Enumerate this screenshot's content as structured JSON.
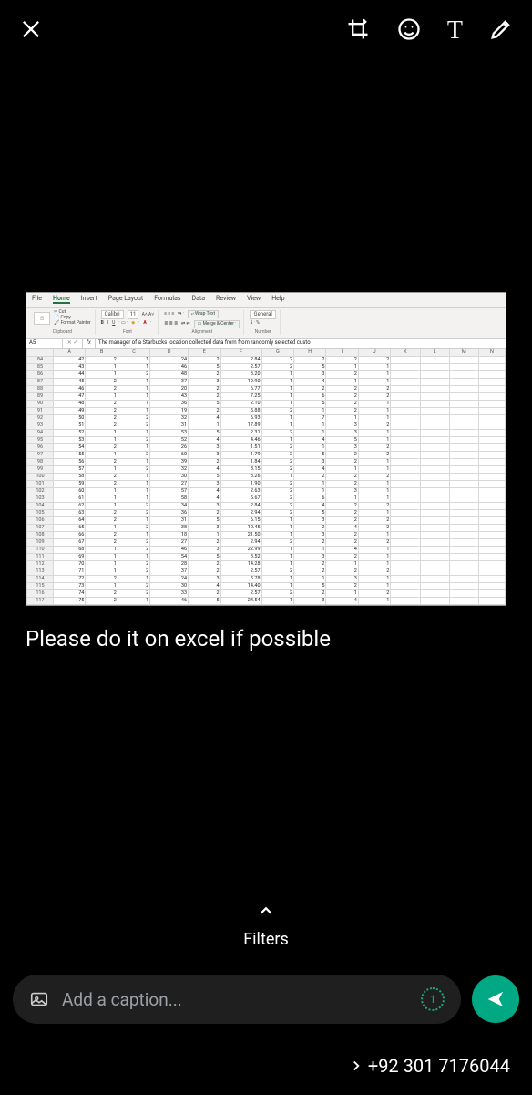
{
  "topbar": {
    "close": "close-icon",
    "crop": "crop-icon",
    "smile": "smiley-icon",
    "text": "T",
    "pen": "pen-icon"
  },
  "excel": {
    "tabs": [
      "File",
      "Home",
      "Insert",
      "Page Layout",
      "Formulas",
      "Data",
      "Review",
      "View",
      "Help"
    ],
    "active_tab": "Home",
    "clipboard": {
      "paste": "Paste",
      "cut": "Cut",
      "copy": "Copy",
      "fmt": "Format Painter",
      "label": "Clipboard"
    },
    "font": {
      "name": "Calibri",
      "size": "11",
      "aa": "A˄ A˅",
      "biu": "B I U",
      "label": "Font"
    },
    "alignment": {
      "wrap": "Wrap Text",
      "merge": "Merge & Center",
      "label": "Alignment"
    },
    "number": {
      "general": "General",
      "fmt": "$ · % ,",
      "label": "Number"
    },
    "namebox": "A5",
    "fx": "fx",
    "formula": "The manager of a Starbucks location collected data from from randomly selected custo",
    "cols": [
      "",
      "A",
      "B",
      "C",
      "D",
      "E",
      "F",
      "G",
      "H",
      "I",
      "J",
      "K",
      "L",
      "M",
      "N"
    ],
    "rows": [
      {
        "r": "84",
        "c": [
          "42",
          "2",
          "1",
          "24",
          "2",
          "2.84",
          "2",
          "2",
          "2",
          "2",
          "",
          "",
          "",
          ""
        ]
      },
      {
        "r": "85",
        "c": [
          "43",
          "1",
          "1",
          "46",
          "5",
          "2.57",
          "2",
          "5",
          "1",
          "1",
          "",
          "",
          "",
          ""
        ]
      },
      {
        "r": "86",
        "c": [
          "44",
          "1",
          "2",
          "48",
          "2",
          "3.20",
          "1",
          "3",
          "2",
          "1",
          "",
          "",
          "",
          ""
        ]
      },
      {
        "r": "87",
        "c": [
          "45",
          "2",
          "1",
          "37",
          "3",
          "19.90",
          "1",
          "4",
          "1",
          "1",
          "",
          "",
          "",
          ""
        ]
      },
      {
        "r": "88",
        "c": [
          "46",
          "2",
          "1",
          "20",
          "2",
          "6.77",
          "1",
          "2",
          "2",
          "2",
          "",
          "",
          "",
          ""
        ]
      },
      {
        "r": "89",
        "c": [
          "47",
          "1",
          "1",
          "43",
          "2",
          "7.25",
          "1",
          "6",
          "2",
          "2",
          "",
          "",
          "",
          ""
        ]
      },
      {
        "r": "90",
        "c": [
          "48",
          "2",
          "1",
          "36",
          "5",
          "2.10",
          "1",
          "5",
          "2",
          "1",
          "",
          "",
          "",
          ""
        ]
      },
      {
        "r": "91",
        "c": [
          "49",
          "2",
          "1",
          "19",
          "2",
          "5.88",
          "2",
          "1",
          "2",
          "1",
          "",
          "",
          "",
          ""
        ]
      },
      {
        "r": "92",
        "c": [
          "50",
          "2",
          "2",
          "32",
          "4",
          "6.93",
          "1",
          "7",
          "1",
          "1",
          "",
          "",
          "",
          ""
        ]
      },
      {
        "r": "93",
        "c": [
          "51",
          "2",
          "2",
          "31",
          "1",
          "17.89",
          "1",
          "1",
          "3",
          "2",
          "",
          "",
          "",
          ""
        ]
      },
      {
        "r": "94",
        "c": [
          "52",
          "1",
          "1",
          "53",
          "5",
          "2.31",
          "2",
          "1",
          "3",
          "1",
          "",
          "",
          "",
          ""
        ]
      },
      {
        "r": "95",
        "c": [
          "53",
          "1",
          "2",
          "52",
          "4",
          "4.46",
          "1",
          "4",
          "5",
          "1",
          "",
          "",
          "",
          ""
        ]
      },
      {
        "r": "96",
        "c": [
          "54",
          "2",
          "1",
          "26",
          "3",
          "1.51",
          "2",
          "1",
          "3",
          "2",
          "",
          "",
          "",
          ""
        ]
      },
      {
        "r": "97",
        "c": [
          "55",
          "1",
          "2",
          "60",
          "3",
          "1.79",
          "2",
          "5",
          "2",
          "2",
          "",
          "",
          "",
          ""
        ]
      },
      {
        "r": "98",
        "c": [
          "56",
          "2",
          "1",
          "39",
          "2",
          "1.84",
          "2",
          "3",
          "2",
          "1",
          "",
          "",
          "",
          ""
        ]
      },
      {
        "r": "99",
        "c": [
          "57",
          "1",
          "2",
          "32",
          "4",
          "3.15",
          "2",
          "4",
          "1",
          "1",
          "",
          "",
          "",
          ""
        ]
      },
      {
        "r": "100",
        "c": [
          "58",
          "2",
          "1",
          "30",
          "5",
          "3.26",
          "1",
          "2",
          "2",
          "2",
          "",
          "",
          "",
          ""
        ]
      },
      {
        "r": "101",
        "c": [
          "59",
          "2",
          "1",
          "27",
          "3",
          "1.90",
          "2",
          "1",
          "2",
          "1",
          "",
          "",
          "",
          ""
        ]
      },
      {
        "r": "102",
        "c": [
          "60",
          "1",
          "1",
          "57",
          "4",
          "2.63",
          "2",
          "1",
          "3",
          "1",
          "",
          "",
          "",
          ""
        ]
      },
      {
        "r": "103",
        "c": [
          "61",
          "1",
          "1",
          "58",
          "4",
          "5.67",
          "2",
          "6",
          "1",
          "1",
          "",
          "",
          "",
          ""
        ]
      },
      {
        "r": "104",
        "c": [
          "62",
          "1",
          "2",
          "34",
          "3",
          "2.84",
          "2",
          "4",
          "2",
          "2",
          "",
          "",
          "",
          ""
        ]
      },
      {
        "r": "105",
        "c": [
          "63",
          "2",
          "2",
          "36",
          "2",
          "2.94",
          "2",
          "5",
          "2",
          "1",
          "",
          "",
          "",
          ""
        ]
      },
      {
        "r": "106",
        "c": [
          "64",
          "2",
          "1",
          "31",
          "5",
          "6.15",
          "1",
          "3",
          "2",
          "2",
          "",
          "",
          "",
          ""
        ]
      },
      {
        "r": "107",
        "c": [
          "65",
          "1",
          "2",
          "38",
          "3",
          "10.45",
          "1",
          "2",
          "4",
          "2",
          "",
          "",
          "",
          ""
        ]
      },
      {
        "r": "108",
        "c": [
          "66",
          "2",
          "1",
          "18",
          "1",
          "21.50",
          "1",
          "3",
          "2",
          "1",
          "",
          "",
          "",
          ""
        ]
      },
      {
        "r": "109",
        "c": [
          "67",
          "2",
          "2",
          "27",
          "2",
          "2.94",
          "2",
          "2",
          "2",
          "2",
          "",
          "",
          "",
          ""
        ]
      },
      {
        "r": "110",
        "c": [
          "68",
          "1",
          "2",
          "46",
          "3",
          "22.99",
          "1",
          "1",
          "4",
          "1",
          "",
          "",
          "",
          ""
        ]
      },
      {
        "r": "111",
        "c": [
          "69",
          "1",
          "1",
          "54",
          "5",
          "3.52",
          "1",
          "3",
          "2",
          "1",
          "",
          "",
          "",
          ""
        ]
      },
      {
        "r": "112",
        "c": [
          "70",
          "1",
          "2",
          "28",
          "2",
          "14.28",
          "1",
          "2",
          "1",
          "1",
          "",
          "",
          "",
          ""
        ]
      },
      {
        "r": "113",
        "c": [
          "71",
          "1",
          "2",
          "37",
          "2",
          "2.57",
          "2",
          "2",
          "2",
          "2",
          "",
          "",
          "",
          ""
        ]
      },
      {
        "r": "114",
        "c": [
          "72",
          "2",
          "1",
          "24",
          "3",
          "5.78",
          "1",
          "1",
          "3",
          "1",
          "",
          "",
          "",
          ""
        ]
      },
      {
        "r": "115",
        "c": [
          "73",
          "1",
          "2",
          "30",
          "4",
          "14.40",
          "1",
          "5",
          "2",
          "1",
          "",
          "",
          "",
          ""
        ]
      },
      {
        "r": "116",
        "c": [
          "74",
          "2",
          "2",
          "33",
          "2",
          "2.57",
          "2",
          "2",
          "1",
          "2",
          "",
          "",
          "",
          ""
        ]
      },
      {
        "r": "117",
        "c": [
          "75",
          "2",
          "1",
          "46",
          "5",
          "24.54",
          "1",
          "3",
          "4",
          "1",
          "",
          "",
          "",
          ""
        ]
      }
    ]
  },
  "caption_text": "Please do it on excel if possible",
  "filters_label": "Filters",
  "caption_placeholder": "Add a caption...",
  "timer": "1",
  "phone": "+92 301 7176044"
}
